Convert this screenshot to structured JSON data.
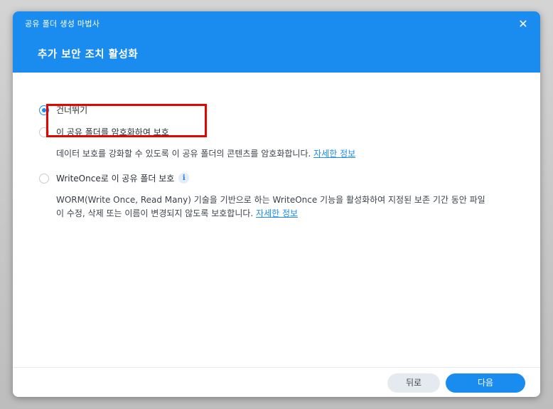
{
  "dialog": {
    "window_title": "공유 폴더 생성 마법사",
    "step_title": "추가 보안 조치 활성화",
    "close_icon": "close-icon"
  },
  "options": [
    {
      "label": "건너뛰기",
      "selected": true
    },
    {
      "label": "이 공유 폴더를 암호화하여 보호",
      "selected": false,
      "description": "데이터 보호를 강화할 수 있도록 이 공유 폴더의 콘텐츠를 암호화합니다.",
      "link": "자세한 정보"
    },
    {
      "label": "WriteOnce로 이 공유 폴더 보호",
      "selected": false,
      "info_icon": "info-icon",
      "description_line1": "WORM(Write Once, Read Many) 기술을 기반으로 하는 WriteOnce 기능을 활성화하여 지정된 보존 기간 동안 파일",
      "description_line2": "이 수정, 삭제 또는 이름이 변경되지 않도록 보호합니다.",
      "link": "자세한 정보"
    }
  ],
  "footer": {
    "back_label": "뒤로",
    "next_label": "다음"
  },
  "colors": {
    "accent": "#1a8cf0",
    "highlight": "#e10600"
  }
}
